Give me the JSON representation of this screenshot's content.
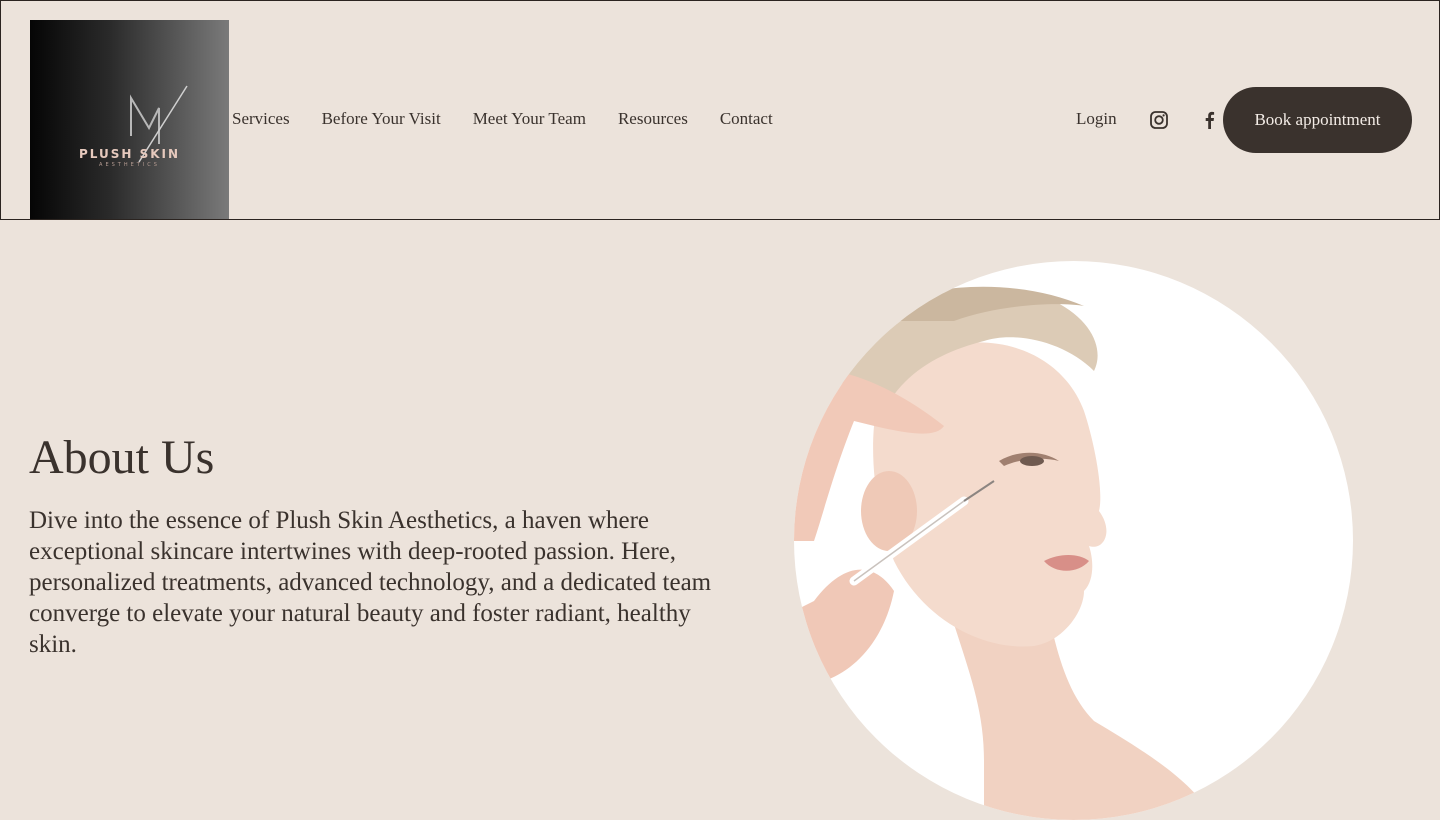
{
  "brand": {
    "name": "PLUSH SKIN",
    "sub": "AESTHETICS"
  },
  "nav": {
    "services": "Services",
    "before_visit": "Before Your Visit",
    "team": "Meet Your Team",
    "resources": "Resources",
    "contact": "Contact"
  },
  "header": {
    "login": "Login",
    "book": "Book appointment",
    "icons": [
      "instagram-icon",
      "facebook-icon"
    ]
  },
  "about": {
    "title": "About Us",
    "body": "Dive into the essence of Plush Skin Aesthetics, a haven where exceptional skincare intertwines with deep-rooted passion. Here, personalized treatments, advanced technology, and a dedicated team converge to elevate your natural beauty and foster radiant, healthy skin."
  },
  "colors": {
    "background": "#ece3db",
    "text": "#3a322d",
    "button": "#3a322d",
    "logo_accent": "#e6c9bd"
  }
}
